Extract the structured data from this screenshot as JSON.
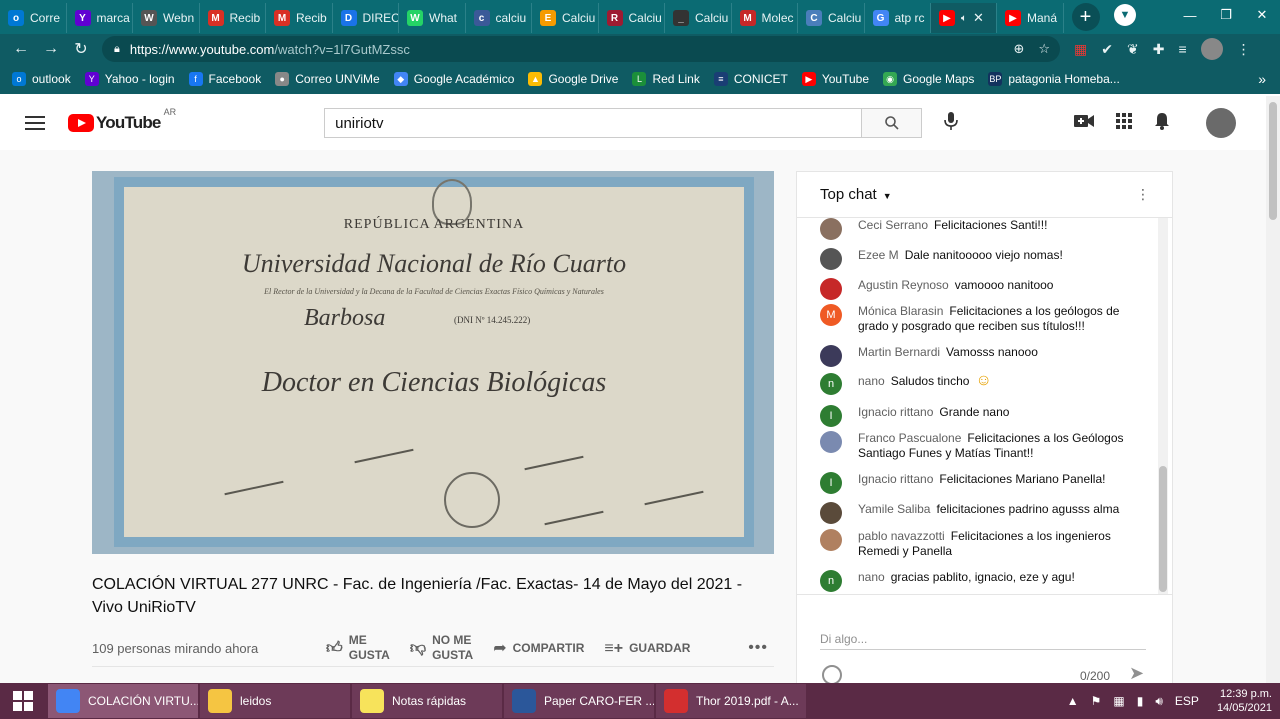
{
  "browser": {
    "tabs": [
      {
        "label": "Corre",
        "color": "#0078d4",
        "glyph": "o"
      },
      {
        "label": "marca",
        "color": "#6001d2",
        "glyph": "Y"
      },
      {
        "label": "Webn",
        "color": "#555555",
        "glyph": "W"
      },
      {
        "label": "Recib",
        "color": "#d93025",
        "glyph": "M"
      },
      {
        "label": "Recib",
        "color": "#d93025",
        "glyph": "M"
      },
      {
        "label": "DIREC",
        "color": "#1a73e8",
        "glyph": "D"
      },
      {
        "label": "What",
        "color": "#25d366",
        "glyph": "W"
      },
      {
        "label": "calciu",
        "color": "#3b5998",
        "glyph": "c"
      },
      {
        "label": "Calciu",
        "color": "#f59b00",
        "glyph": "E"
      },
      {
        "label": "Calciu",
        "color": "#9e1b32",
        "glyph": "R"
      },
      {
        "label": "Calciu",
        "color": "#333333",
        "glyph": "_"
      },
      {
        "label": "Molec",
        "color": "#c62828",
        "glyph": "M"
      },
      {
        "label": "Calciu",
        "color": "#4a7ebb",
        "glyph": "C"
      },
      {
        "label": "atp rc",
        "color": "#4285f4",
        "glyph": "G"
      },
      {
        "label": "",
        "color": "#ff0000",
        "glyph": "▶",
        "active": true
      },
      {
        "label": "Maná",
        "color": "#ff0000",
        "glyph": "▶"
      }
    ],
    "active_tab_close": "✕",
    "new_tab": "+",
    "window_controls": {
      "minimize": "—",
      "restore": "❐",
      "close": "✕"
    },
    "url_domain": "https://www.youtube.com",
    "url_path": "/watch?v=1l7GutMZssc",
    "bookmarks": [
      {
        "label": "outlook",
        "color": "#0078d4",
        "glyph": "o"
      },
      {
        "label": "Yahoo - login",
        "color": "#6001d2",
        "glyph": "Y"
      },
      {
        "label": "Facebook",
        "color": "#1877f2",
        "glyph": "f"
      },
      {
        "label": "Correo UNViMe",
        "color": "#888888",
        "glyph": "●"
      },
      {
        "label": "Google Académico",
        "color": "#4285f4",
        "glyph": "◆"
      },
      {
        "label": "Google Drive",
        "color": "#fbbc04",
        "glyph": "▲"
      },
      {
        "label": "Red Link",
        "color": "#1b8f3a",
        "glyph": "L"
      },
      {
        "label": "CONICET",
        "color": "#1a3e74",
        "glyph": "≡"
      },
      {
        "label": "YouTube",
        "color": "#ff0000",
        "glyph": "▶"
      },
      {
        "label": "Google Maps",
        "color": "#34a853",
        "glyph": "◉"
      },
      {
        "label": "patagonia Homeba...",
        "color": "#12325e",
        "glyph": "BP"
      }
    ],
    "bookmarks_more": "»"
  },
  "youtube": {
    "logo_text": "YouTube",
    "country_code": "AR",
    "search_value": "uniriotv",
    "video": {
      "title": "COLACIÓN VIRTUAL 277 UNRC - Fac. de Ingeniería /Fac. Exactas- 14 de Mayo del 2021 - Vivo UniRioTV",
      "viewers": "109 personas mirando ahora",
      "dislike_label_1": "NO ME",
      "dislike_label_2": "GUSTA",
      "like_label_1": "ME",
      "like_label_2": "GUSTA",
      "share_label": "COMPARTIR",
      "save_label": "GUARDAR",
      "diploma": {
        "country": "REPÚBLICA   ARGENTINA",
        "university": "Universidad Nacional de Río Cuarto",
        "line1": "El Rector de la Universidad y la Decana de la Facultad de Ciencias Exactas Físico Químicas y Naturales",
        "name": "Barbosa",
        "dni": "(DNI Nº 14.245.222)",
        "degree": "Doctor en Ciencias Biológicas"
      }
    },
    "chat": {
      "header": "Top chat",
      "messages": [
        {
          "author": "Ceci Serrano",
          "text": "Felicitaciones Santi!!!",
          "color": "#8a7060",
          "initial": ""
        },
        {
          "author": "Ezee M",
          "text": "Dale nanitooooo viejo nomas!",
          "color": "#555555",
          "initial": ""
        },
        {
          "author": "Agustin Reynoso",
          "text": "vamoooo nanitooo",
          "color": "#c62828",
          "initial": ""
        },
        {
          "author": "Mónica Blarasin",
          "text": "Felicitaciones a los geólogos de grado y posgrado que reciben sus títulos!!!",
          "color": "#ef5a24",
          "initial": "M"
        },
        {
          "author": "Martin Bernardi",
          "text": "Vamosss nanooo",
          "color": "#3c3a5a",
          "initial": ""
        },
        {
          "author": "nano",
          "text": "Saludos tincho",
          "color": "#2e7d32",
          "initial": "n",
          "emoji": "☺"
        },
        {
          "author": "Ignacio rittano",
          "text": "Grande nano",
          "color": "#2e7d32",
          "initial": "I"
        },
        {
          "author": "Franco Pascualone",
          "text": "Felicitaciones a los Geólogos Santiago Funes y Matías Tinant!!",
          "color": "#7a8ab0",
          "initial": ""
        },
        {
          "author": "Ignacio rittano",
          "text": "Felicitaciones Mariano Panella!",
          "color": "#2e7d32",
          "initial": "I"
        },
        {
          "author": "Yamile Saliba",
          "text": "felicitaciones padrino agusss alma",
          "color": "#5a4a3a",
          "initial": ""
        },
        {
          "author": "pablo navazzotti",
          "text": "Felicitaciones a los ingenieros Remedi y Panella",
          "color": "#b08060",
          "initial": ""
        },
        {
          "author": "nano",
          "text": "gracias pablito, ignacio, eze y agu!",
          "color": "#2e7d32",
          "initial": "n"
        }
      ],
      "input_placeholder": "Di algo...",
      "char_counter": "0/200"
    }
  },
  "taskbar": {
    "items": [
      {
        "label": "COLACIÓN VIRTU...",
        "color": "#4285f4",
        "active": true
      },
      {
        "label": "leidos",
        "color": "#f5c542"
      },
      {
        "label": "Notas rápidas",
        "color": "#f7e35b"
      },
      {
        "label": "Paper CARO-FER ...",
        "color": "#2b579a"
      },
      {
        "label": "Thor 2019.pdf - A...",
        "color": "#d32f2f"
      }
    ],
    "language": "ESP",
    "time": "12:39 p.m.",
    "date": "14/05/2021"
  }
}
